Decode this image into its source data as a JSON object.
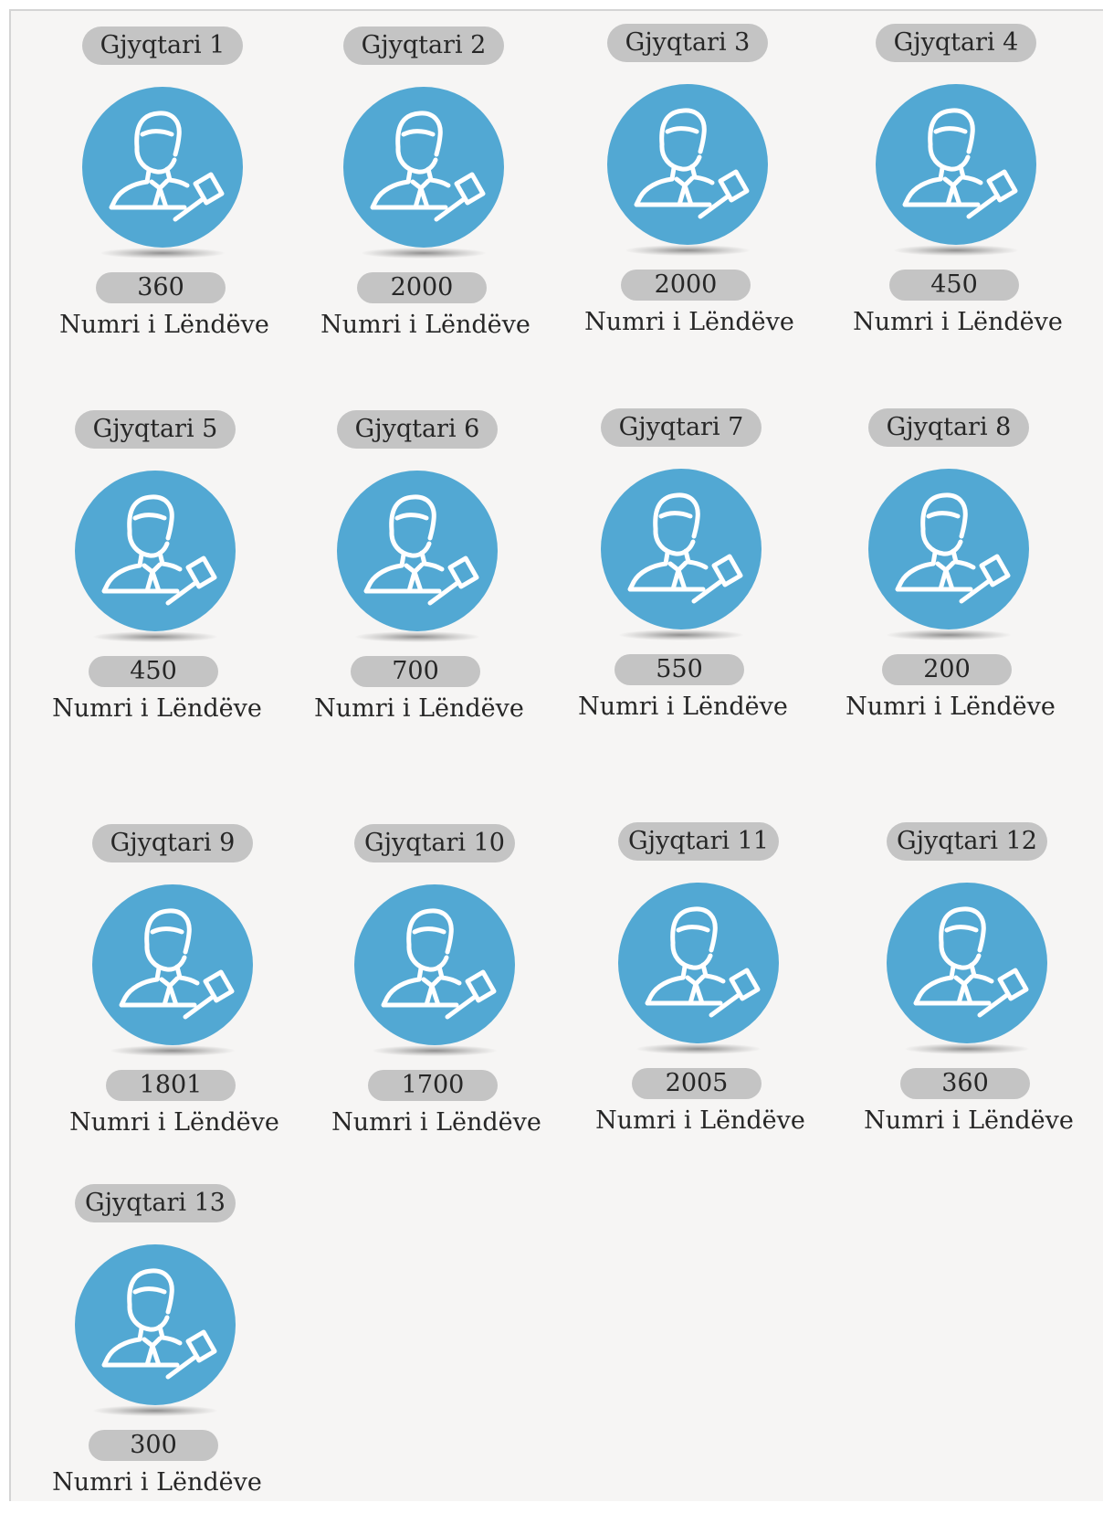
{
  "colors": {
    "avatar_fill": "#52a8d3",
    "pill_fill": "#c4c4c4",
    "text": "#262626",
    "background": "#f6f5f4"
  },
  "icon": "judge-with-gavel-icon",
  "caption": "Numri i Lëndëve",
  "judges": [
    {
      "name": "Gjyqtari 1",
      "count": "360"
    },
    {
      "name": "Gjyqtari 2",
      "count": "2000"
    },
    {
      "name": "Gjyqtari 3",
      "count": "2000"
    },
    {
      "name": "Gjyqtari 4",
      "count": "450"
    },
    {
      "name": "Gjyqtari 5",
      "count": "450"
    },
    {
      "name": "Gjyqtari 6",
      "count": "700"
    },
    {
      "name": "Gjyqtari 7",
      "count": "550"
    },
    {
      "name": "Gjyqtari 8",
      "count": "200"
    },
    {
      "name": "Gjyqtari 9",
      "count": "1801"
    },
    {
      "name": "Gjyqtari 10",
      "count": "1700"
    },
    {
      "name": "Gjyqtari 11",
      "count": "2005"
    },
    {
      "name": "Gjyqtari 12",
      "count": "360"
    },
    {
      "name": "Gjyqtari 13",
      "count": "300"
    }
  ]
}
